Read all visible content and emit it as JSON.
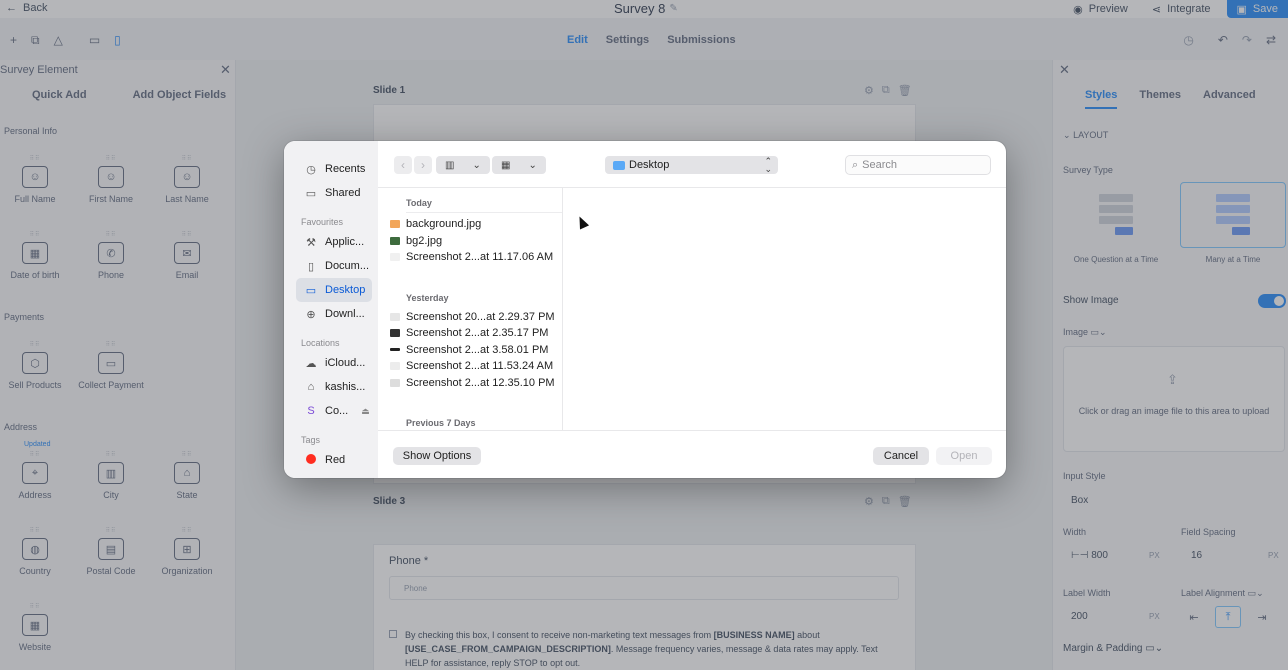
{
  "app": {
    "back_label": "Back",
    "survey_title": "Survey 8",
    "preview_label": "Preview",
    "integrate_label": "Integrate",
    "save_label": "Save",
    "tabs": [
      "Edit",
      "Settings",
      "Submissions"
    ],
    "active_tab": "Edit"
  },
  "left_panel": {
    "title": "Survey Element",
    "tabs": [
      "Quick Add",
      "Add Object Fields"
    ],
    "sections": {
      "personal": "Personal Info",
      "payments": "Payments",
      "address": "Address"
    },
    "elements": {
      "full_name": "Full Name",
      "first_name": "First Name",
      "last_name": "Last Name",
      "dob": "Date of birth",
      "phone": "Phone",
      "email": "Email",
      "sell": "Sell Products",
      "collect": "Collect Payment",
      "address": "Address",
      "city": "City",
      "state": "State",
      "country": "Country",
      "postal": "Postal Code",
      "org": "Organization",
      "website": "Website"
    },
    "updated_badge": "Updated"
  },
  "canvas": {
    "slide1": "Slide 1",
    "slide3": "Slide 3",
    "phone_label": "Phone *",
    "phone_placeholder": "Phone",
    "consent_pre": "By checking this box, I consent to receive non-marketing text messages from ",
    "consent_business": "[BUSINESS NAME]",
    "consent_mid": " about ",
    "consent_campaign": "[USE_CASE_FROM_CAMPAIGN_DESCRIPTION]",
    "consent_post": ". Message frequency varies, message & data rates may apply. Text HELP for assistance, reply STOP to opt out."
  },
  "right_panel": {
    "tabs": [
      "Styles",
      "Themes",
      "Advanced"
    ],
    "active_tab": "Styles",
    "layout_label": "LAYOUT",
    "survey_type_label": "Survey Type",
    "type_one": "One Question at a Time",
    "type_many": "Many at a Time",
    "show_image_label": "Show Image",
    "image_label": "Image",
    "dropzone_text": "Click or drag an image file to this area to upload",
    "input_style_label": "Input Style",
    "input_style_value": "Box",
    "width_label": "Width",
    "width_value": "800",
    "field_spacing_label": "Field Spacing",
    "field_spacing_value": "16",
    "unit_px": "PX",
    "label_width_label": "Label Width",
    "label_width_value": "200",
    "label_alignment_label": "Label Alignment",
    "margin_padding_label": "Margin & Padding"
  },
  "dialog": {
    "sidebar": {
      "recents": "Recents",
      "shared": "Shared",
      "favourites_head": "Favourites",
      "applications": "Applic...",
      "documents": "Docum...",
      "desktop": "Desktop",
      "downloads": "Downl...",
      "locations_head": "Locations",
      "icloud": "iCloud...",
      "home": "kashis...",
      "co": "Co...",
      "tags_head": "Tags",
      "red": "Red"
    },
    "location": "Desktop",
    "search_placeholder": "Search",
    "groups": {
      "today": "Today",
      "yesterday": "Yesterday",
      "previous": "Previous 7 Days"
    },
    "files_today": [
      "background.jpg",
      "bg2.jpg",
      "Screenshot 2...at 11.17.06 AM"
    ],
    "files_yesterday": [
      "Screenshot 20...at 2.29.37 PM",
      "Screenshot 2...at 2.35.17 PM",
      "Screenshot 2...at 3.58.01 PM",
      "Screenshot 2...at 11.53.24 AM",
      "Screenshot 2...at 12.35.10 PM"
    ],
    "show_options": "Show Options",
    "cancel": "Cancel",
    "open": "Open"
  }
}
